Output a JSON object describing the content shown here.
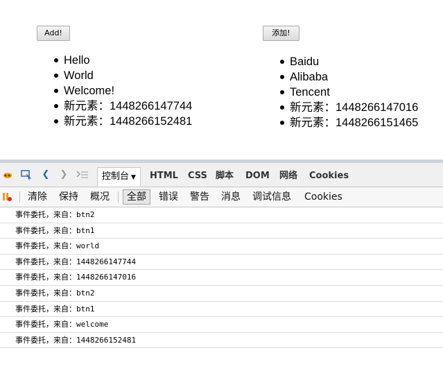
{
  "demo": {
    "btn1_label": "Add!",
    "btn2_label": "添加!",
    "list1": [
      "Hello",
      "World",
      "Welcome!",
      "新元素：1448266147744",
      "新元素：1448266152481"
    ],
    "list2": [
      "Baidu",
      "Alibaba",
      "Tencent",
      "新元素：1448266147016",
      "新元素：1448266151465"
    ]
  },
  "devtools": {
    "tabs": {
      "console": "控制台",
      "html": "HTML",
      "css": "CSS",
      "script": "脚本",
      "dom": "DOM",
      "network": "网络",
      "cookies": "Cookies"
    },
    "toolbar": {
      "clear": "清除",
      "persist": "保持",
      "profile": "概况",
      "all": "全部",
      "errors": "错误",
      "warnings": "警告",
      "info": "消息",
      "debug": "调试信息",
      "cookies": "Cookies"
    },
    "log_prefix": "事件委托，来自：",
    "log": [
      "btn2",
      "btn1",
      "world",
      "1448266147744",
      "1448266147016",
      "btn2",
      "btn1",
      "welcome",
      "1448266152481"
    ]
  },
  "colors": {
    "accent": "#1a5fb4",
    "firebug": "#e8a020"
  }
}
